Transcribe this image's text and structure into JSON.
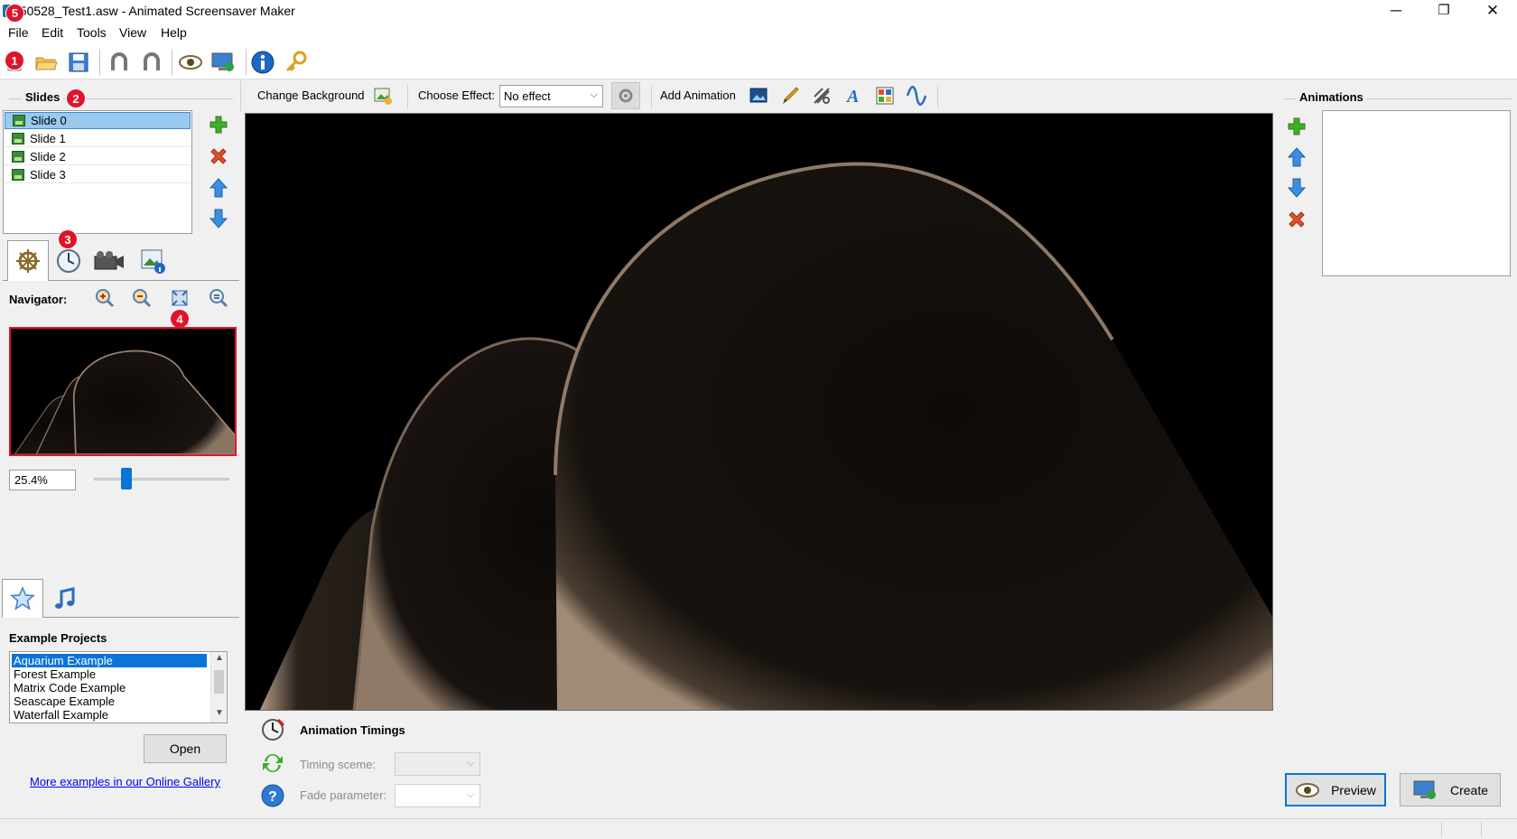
{
  "window": {
    "title": "250528_Test1.asw - Animated Screensaver Maker",
    "minimize": "─",
    "restore": "❐",
    "close": "✕"
  },
  "menu": [
    "File",
    "Edit",
    "Tools",
    "View",
    "Help"
  ],
  "toolbar_icons": [
    "new-icon",
    "open-folder-icon",
    "save-icon",
    "undo-icon",
    "redo-icon",
    "preview-eye-icon",
    "screensaver-icon",
    "info-icon",
    "key-icon"
  ],
  "markers": [
    "1",
    "2",
    "3",
    "4",
    "5"
  ],
  "slides": {
    "title": "Slides",
    "items": [
      "Slide 0",
      "Slide 1",
      "Slide 2",
      "Slide 3"
    ],
    "selected": "Slide 0"
  },
  "navigator": {
    "label": "Navigator:",
    "zoom": "25.4%",
    "zoom_slider_fraction": 0.22
  },
  "examples": {
    "title": "Example Projects",
    "items": [
      "Aquarium Example",
      "Forest Example",
      "Matrix Code Example",
      "Seascape Example",
      "Waterfall Example"
    ],
    "selected": "Aquarium Example",
    "open_label": "Open",
    "gallery_link": "More examples in our Online Gallery"
  },
  "center_toolbar": {
    "change_background": "Change Background",
    "choose_effect_label": "Choose Effect:",
    "effect_value": "No effect",
    "add_animation": "Add Animation"
  },
  "timings": {
    "title": "Animation Timings",
    "timing_scene_label": "Timing sceme:",
    "fade_label": "Fade parameter:"
  },
  "animations": {
    "title": "Animations"
  },
  "buttons": {
    "preview": "Preview",
    "create": "Create"
  },
  "colors": {
    "accent": "#0a74d9",
    "marker": "#e0142a",
    "selection": "#99c9ef"
  }
}
